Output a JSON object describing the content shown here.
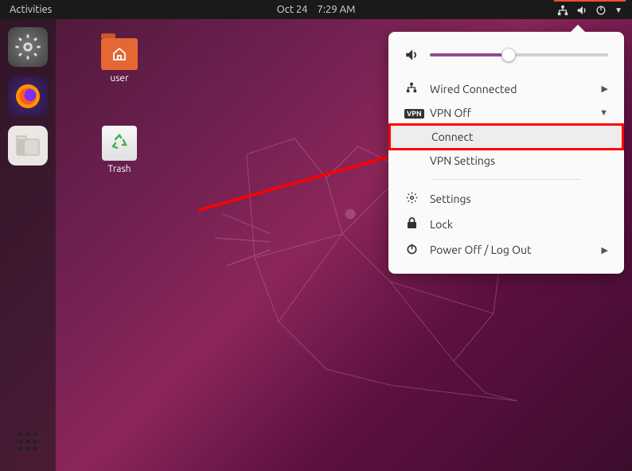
{
  "topbar": {
    "activities": "Activities",
    "date": "Oct 24",
    "time": "7:29 AM"
  },
  "desktop_icons": {
    "home": "user",
    "trash": "Trash"
  },
  "menu": {
    "wired": "Wired Connected",
    "vpn": "VPN Off",
    "connect": "Connect",
    "vpn_settings": "VPN Settings",
    "settings": "Settings",
    "lock": "Lock",
    "power": "Power Off / Log Out"
  },
  "volume": {
    "percent": 44
  },
  "highlight": "connect"
}
